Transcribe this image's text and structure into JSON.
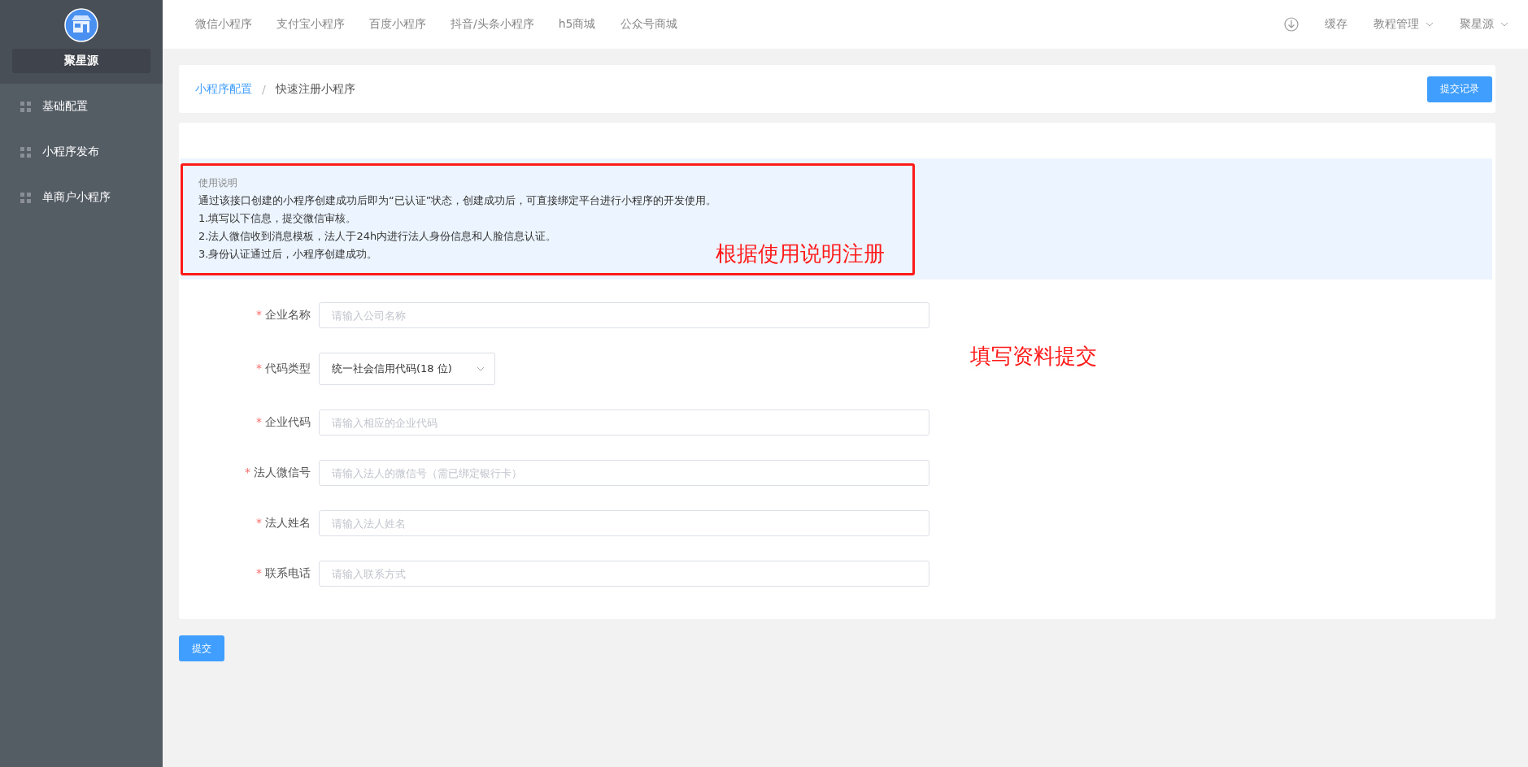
{
  "sidebar": {
    "brand": "聚星源",
    "items": [
      {
        "label": "基础配置"
      },
      {
        "label": "小程序发布"
      },
      {
        "label": "单商户小程序"
      }
    ]
  },
  "top_nav": {
    "links": [
      "微信小程序",
      "支付宝小程序",
      "百度小程序",
      "抖音/头条小程序",
      "h5商城",
      "公众号商城"
    ],
    "cache": "缓存",
    "menus": [
      "教程管理",
      "聚星源"
    ]
  },
  "breadcrumb": {
    "items": [
      "小程序配置",
      "快速注册小程序"
    ],
    "separator": "/",
    "button": "提交记录"
  },
  "notice": {
    "title": "使用说明",
    "lines": [
      "通过该接口创建的小程序创建成功后即为“已认证”状态，创建成功后，可直接绑定平台进行小程序的开发使用。",
      "1.填写以下信息，提交微信审核。",
      "2.法人微信收到消息模板，法人于24h内进行法人身份信息和人脸信息认证。",
      "3.身份认证通过后，小程序创建成功。"
    ]
  },
  "annotations": [
    "根据使用说明注册",
    "填写资料提交"
  ],
  "form": [
    {
      "kind": "input",
      "label": "企业名称",
      "required_mark": "*",
      "placeholder": "请输入公司名称"
    },
    {
      "kind": "select",
      "label": "代码类型",
      "required_mark": "*",
      "value": "统一社会信用代码(18 位)"
    },
    {
      "kind": "input",
      "label": "企业代码",
      "required_mark": "*",
      "placeholder": "请输入相应的企业代码"
    },
    {
      "kind": "input",
      "label": "法人微信号",
      "required_mark": "*",
      "placeholder": "请输入法人的微信号（需已绑定银行卡）"
    },
    {
      "kind": "input",
      "label": "法人姓名",
      "required_mark": "*",
      "placeholder": "请输入法人姓名"
    },
    {
      "kind": "input",
      "label": "联系电话",
      "required_mark": "*",
      "placeholder": "请输入联系方式"
    }
  ],
  "submit": "提交"
}
